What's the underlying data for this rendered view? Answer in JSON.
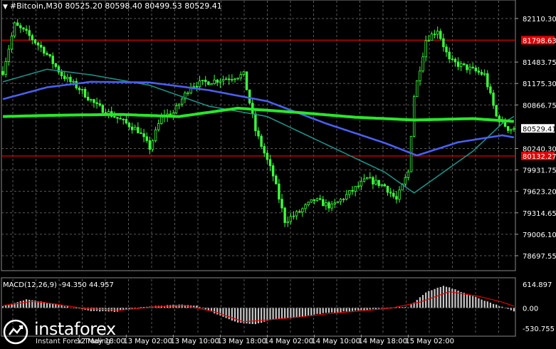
{
  "header": {
    "text": "#Bitcoin,M30  80525.20 80598.40 80499.53 80529.41"
  },
  "macd_label": "MACD(12,26,9) -94.350 44.957",
  "logo": {
    "name": "instaforex",
    "tagline": "Instant Forex Trading"
  },
  "colors": {
    "background": "#000000",
    "grid": "#5a5a5a",
    "candle": "#3cff3c",
    "ma_slow": "#27e827",
    "ma_mid": "#4a5ff0",
    "ma_fast": "#1f8f84",
    "level_line": "#e00000",
    "axis_text": "#ffffff",
    "macd_hist": "#c8c8c8",
    "macd_signal": "#e00000"
  },
  "chart_data": {
    "type": "candlestick",
    "symbol": "#Bitcoin",
    "timeframe": "M30",
    "ohlc_last": {
      "open": 80525.2,
      "high": 80598.4,
      "low": 80499.53,
      "close": 80529.41
    },
    "y_ticks": [
      "82110.30",
      "81483.75",
      "81175.30",
      "80866.75",
      "80240.30",
      "79931.75",
      "79623.20",
      "79314.65",
      "79006.10",
      "78697.55"
    ],
    "ylim": [
      78697.55,
      82110.3
    ],
    "x_ticks": [
      "12 May 18:00",
      "13 May 02:00",
      "13 May 10:00",
      "13 May 18:00",
      "14 May 02:00",
      "14 May 10:00",
      "14 May 18:00",
      "15 May 02:00"
    ],
    "x_tick_bars": [
      26,
      42,
      58,
      74,
      90,
      106,
      122,
      138
    ],
    "bar_count": 175,
    "current_price": {
      "label": "80529.41",
      "value": 80529.41
    },
    "levels": [
      {
        "label": "81798.63",
        "value": 81798.63
      },
      {
        "label": "80132.27",
        "value": 80132.27
      }
    ],
    "price_path": [
      [
        0,
        81350
      ],
      [
        4,
        82020
      ],
      [
        8,
        81900
      ],
      [
        14,
        81650
      ],
      [
        20,
        81300
      ],
      [
        26,
        81100
      ],
      [
        32,
        80850
      ],
      [
        40,
        80650
      ],
      [
        46,
        80500
      ],
      [
        50,
        80250
      ],
      [
        54,
        80700
      ],
      [
        58,
        80750
      ],
      [
        64,
        81150
      ],
      [
        70,
        81200
      ],
      [
        76,
        81250
      ],
      [
        82,
        81300
      ],
      [
        86,
        80500
      ],
      [
        92,
        79850
      ],
      [
        96,
        79200
      ],
      [
        100,
        79300
      ],
      [
        106,
        79500
      ],
      [
        112,
        79400
      ],
      [
        118,
        79600
      ],
      [
        124,
        79800
      ],
      [
        130,
        79700
      ],
      [
        134,
        79500
      ],
      [
        138,
        79900
      ],
      [
        140,
        81000
      ],
      [
        144,
        81800
      ],
      [
        148,
        81950
      ],
      [
        152,
        81500
      ],
      [
        158,
        81400
      ],
      [
        164,
        81300
      ],
      [
        168,
        80700
      ],
      [
        172,
        80529
      ]
    ],
    "ma_slow": [
      [
        0,
        80700
      ],
      [
        20,
        80720
      ],
      [
        40,
        80730
      ],
      [
        60,
        80700
      ],
      [
        80,
        80820
      ],
      [
        100,
        80760
      ],
      [
        120,
        80690
      ],
      [
        140,
        80650
      ],
      [
        160,
        80670
      ],
      [
        174,
        80630
      ]
    ],
    "ma_mid": [
      [
        0,
        80950
      ],
      [
        15,
        81120
      ],
      [
        30,
        81200
      ],
      [
        50,
        81190
      ],
      [
        70,
        81080
      ],
      [
        90,
        80920
      ],
      [
        110,
        80600
      ],
      [
        130,
        80320
      ],
      [
        141,
        80140
      ],
      [
        155,
        80330
      ],
      [
        170,
        80430
      ],
      [
        174,
        80400
      ]
    ],
    "ma_fast": [
      [
        0,
        81200
      ],
      [
        15,
        81380
      ],
      [
        30,
        81300
      ],
      [
        50,
        81150
      ],
      [
        70,
        80850
      ],
      [
        90,
        80700
      ],
      [
        110,
        80300
      ],
      [
        130,
        79900
      ],
      [
        140,
        79600
      ],
      [
        150,
        79900
      ],
      [
        160,
        80200
      ],
      [
        170,
        80600
      ],
      [
        174,
        80700
      ]
    ],
    "macd": {
      "label": "MACD(12,26,9)",
      "main": -94.35,
      "signal": 44.957,
      "y_ticks": [
        "614.897",
        "0.00",
        "-530.755"
      ],
      "ylim": [
        -530.755,
        614.897
      ],
      "hist_path": [
        [
          0,
          50
        ],
        [
          8,
          220
        ],
        [
          14,
          150
        ],
        [
          22,
          30
        ],
        [
          30,
          -80
        ],
        [
          38,
          -100
        ],
        [
          46,
          0
        ],
        [
          52,
          50
        ],
        [
          60,
          80
        ],
        [
          66,
          60
        ],
        [
          74,
          -200
        ],
        [
          80,
          -380
        ],
        [
          86,
          -430
        ],
        [
          92,
          -300
        ],
        [
          100,
          -250
        ],
        [
          108,
          -150
        ],
        [
          116,
          -100
        ],
        [
          124,
          -50
        ],
        [
          132,
          10
        ],
        [
          138,
          20
        ],
        [
          144,
          400
        ],
        [
          150,
          580
        ],
        [
          156,
          420
        ],
        [
          162,
          250
        ],
        [
          168,
          80
        ],
        [
          174,
          -94
        ]
      ],
      "signal_path": [
        [
          0,
          60
        ],
        [
          10,
          170
        ],
        [
          18,
          100
        ],
        [
          28,
          -20
        ],
        [
          40,
          -60
        ],
        [
          52,
          30
        ],
        [
          62,
          60
        ],
        [
          72,
          -100
        ],
        [
          82,
          -360
        ],
        [
          92,
          -300
        ],
        [
          102,
          -230
        ],
        [
          112,
          -140
        ],
        [
          122,
          -80
        ],
        [
          132,
          -10
        ],
        [
          142,
          150
        ],
        [
          152,
          420
        ],
        [
          162,
          300
        ],
        [
          170,
          150
        ],
        [
          174,
          45
        ]
      ]
    }
  }
}
